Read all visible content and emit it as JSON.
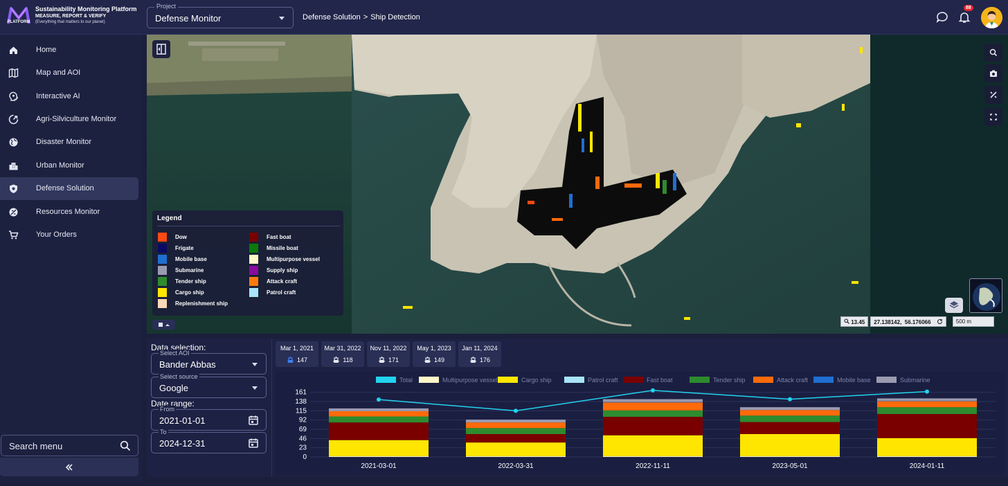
{
  "header": {
    "brand_title": "Sustainability Monitoring Platform",
    "brand_subtitle": "MEASURE, REPORT & VERIFY",
    "brand_tagline": "(Everything that matters to our planet)",
    "logo_text": "PLATFORM",
    "project_label": "Project",
    "project_value": "Defense Monitor",
    "breadcrumb": [
      "Defense Solution",
      "Ship Detection"
    ],
    "breadcrumb_sep": ">",
    "notification_count": "88"
  },
  "sidebar": {
    "items": [
      {
        "label": "Home",
        "icon": "home-icon"
      },
      {
        "label": "Map and AOI",
        "icon": "map-icon"
      },
      {
        "label": "Interactive AI",
        "icon": "brain-icon"
      },
      {
        "label": "Agri-Silviculture Monitor",
        "icon": "leaf-icon"
      },
      {
        "label": "Disaster Monitor",
        "icon": "globe-icon"
      },
      {
        "label": "Urban Monitor",
        "icon": "city-icon"
      },
      {
        "label": "Defense Solution",
        "icon": "shield-icon",
        "active": true
      },
      {
        "label": "Resources Monitor",
        "icon": "resources-icon"
      },
      {
        "label": "Your Orders",
        "icon": "cart-icon"
      }
    ],
    "search_placeholder": "Search menu",
    "collapse_label": "«"
  },
  "map": {
    "legend_title": "Legend",
    "legend_left": [
      {
        "label": "Dow",
        "color": "#ff4a12"
      },
      {
        "label": "Frigate",
        "color": "#0a0a66"
      },
      {
        "label": "Mobile base",
        "color": "#1f6fd1"
      },
      {
        "label": "Submarine",
        "color": "#9a9ab0"
      },
      {
        "label": "Tender ship",
        "color": "#2e8b2e"
      },
      {
        "label": "Cargo ship",
        "color": "#ffe600"
      },
      {
        "label": "Replenishment ship",
        "color": "#ffd8b8"
      }
    ],
    "legend_right": [
      {
        "label": "Fast boat",
        "color": "#7a0000"
      },
      {
        "label": "Missile boat",
        "color": "#0b7a0b"
      },
      {
        "label": "Multipurpose vessel",
        "color": "#fff7c9"
      },
      {
        "label": "Supply ship",
        "color": "#8a0aa0"
      },
      {
        "label": "Attack craft",
        "color": "#ff7a0a"
      },
      {
        "label": "Patrol craft",
        "color": "#a8e4f8"
      }
    ],
    "zoom": "13.45",
    "coordinates": "27.138142,  56.176066",
    "scale": "500 m"
  },
  "data_selection": {
    "title": "Data selection:",
    "aoi_label": "Select AOI",
    "aoi_value": "Bander Abbas",
    "source_label": "Select source",
    "source_value": "Google",
    "date_range_title": "Date range:",
    "from_label": "From",
    "from_value": "2021-01-01",
    "to_label": "To",
    "to_value": "2024-12-31"
  },
  "date_cards": [
    {
      "date": "Mar 1, 2021",
      "count": "147",
      "active": true
    },
    {
      "date": "Mar 31, 2022",
      "count": "118"
    },
    {
      "date": "Nov 11, 2022",
      "count": "171"
    },
    {
      "date": "May 1, 2023",
      "count": "149"
    },
    {
      "date": "Jan 11, 2024",
      "count": "176"
    }
  ],
  "chart_data": {
    "type": "bar",
    "stacked": true,
    "categories": [
      "2021-03-01",
      "2022-03-31",
      "2022-11-11",
      "2023-05-01",
      "2024-01-11"
    ],
    "y_ticks": [
      0,
      23,
      46,
      69,
      92,
      115,
      138,
      161
    ],
    "ylim": [
      0,
      164
    ],
    "legend_placement": "top-center",
    "series": [
      {
        "name": "Total",
        "type": "line",
        "color": "#22d3ee",
        "values": [
          143,
          115,
          166,
          144,
          163
        ]
      },
      {
        "name": "Multipurpose vessel",
        "color": "#fff7c9",
        "values": [
          2,
          2,
          2,
          2,
          2
        ]
      },
      {
        "name": "Cargo ship",
        "color": "#ffe600",
        "values": [
          40,
          34,
          52,
          55,
          45
        ]
      },
      {
        "name": "Patrol craft",
        "color": "#a8e4f8",
        "values": [
          0,
          0,
          0,
          0,
          0
        ]
      },
      {
        "name": "Fast boat",
        "color": "#7a0000",
        "values": [
          44,
          21,
          46,
          30,
          60
        ]
      },
      {
        "name": "Tender ship",
        "color": "#2e8b2e",
        "values": [
          15,
          15,
          16,
          16,
          17
        ]
      },
      {
        "name": "Attack craft",
        "color": "#ff6a0a",
        "values": [
          13,
          14,
          20,
          14,
          15
        ]
      },
      {
        "name": "Mobile base",
        "color": "#1f6fd1",
        "values": [
          0,
          0,
          1,
          0,
          1
        ]
      },
      {
        "name": "Submarine",
        "color": "#9a9ab0",
        "values": [
          7,
          7,
          7,
          7,
          6
        ]
      }
    ]
  }
}
